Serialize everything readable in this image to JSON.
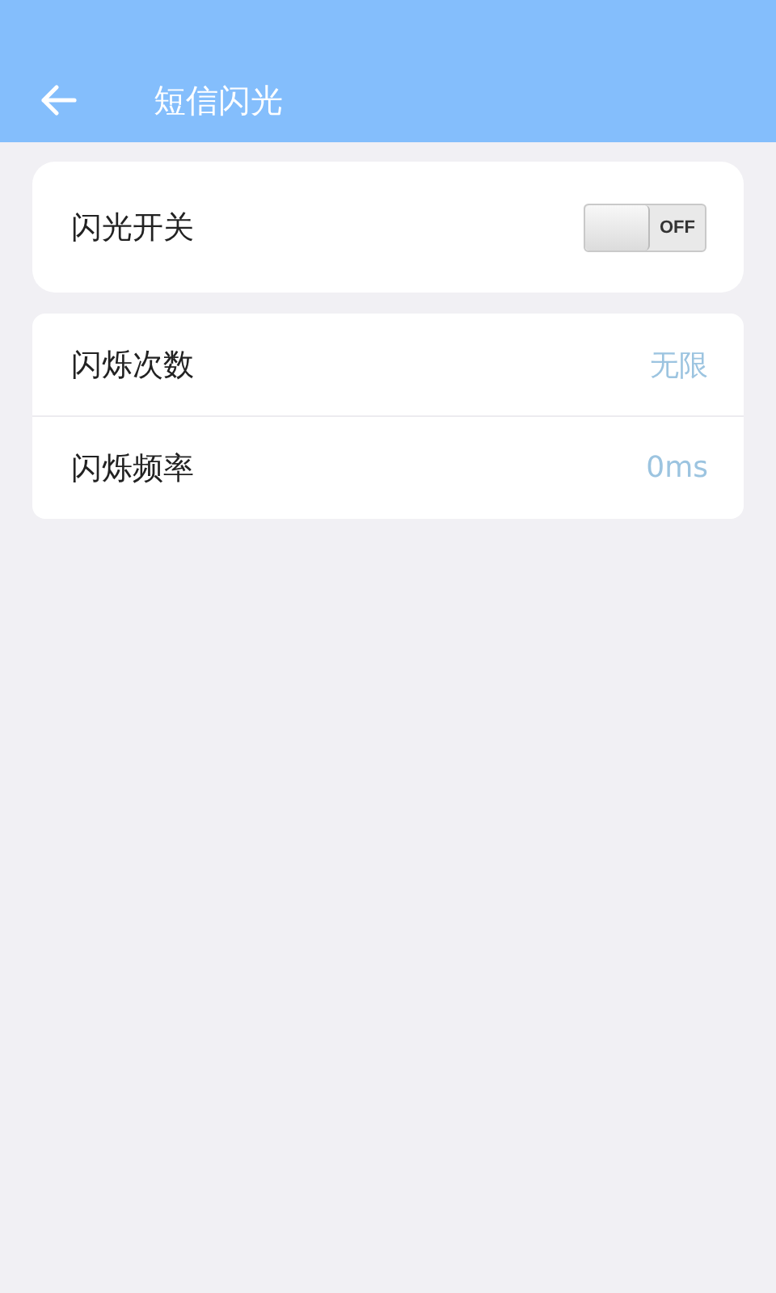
{
  "app_bar": {
    "title": "短信闪光"
  },
  "switch_card": {
    "label": "闪光开关",
    "toggle": {
      "on": false,
      "text": "OFF"
    }
  },
  "settings": [
    {
      "label": "闪烁次数",
      "value": "无限"
    },
    {
      "label": "闪烁频率",
      "value": "0ms"
    }
  ]
}
